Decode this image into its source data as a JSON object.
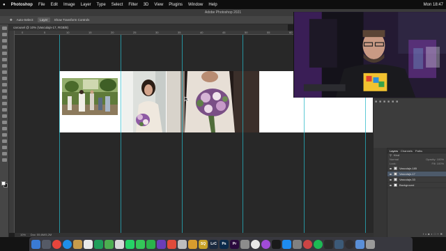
{
  "menubar": {
    "apple": "",
    "items": [
      "Photoshop",
      "File",
      "Edit",
      "Image",
      "Layer",
      "Type",
      "Select",
      "Filter",
      "3D",
      "View",
      "Plugins",
      "Window",
      "Help"
    ],
    "clock": "Mon 18:47"
  },
  "window": {
    "title": "Adobe Photoshop 2021"
  },
  "options": {
    "auto_select": "Auto-Select:",
    "layer_select": "Layer",
    "transform_controls": "Show Transform Controls"
  },
  "document": {
    "tab": "carousel @ 10% (Vasculajn-17, RGB/8)"
  },
  "status": {
    "zoom": "10%",
    "doc_size": "Doc: 55,6M/5,2M"
  },
  "ruler": [
    "0",
    "5",
    "10",
    "15",
    "20",
    "25",
    "30",
    "35",
    "40",
    "45",
    "50",
    "55",
    "60",
    "65",
    "70",
    "75"
  ],
  "layers": {
    "tabs": [
      "Layers",
      "Channels",
      "Paths"
    ],
    "kind": "Kind",
    "blend": "Normal",
    "opacity_label": "Opacity: 100%",
    "lock_label": "Lock:",
    "fill_label": "Fill: 100%",
    "items": [
      {
        "name": "Vasculajn-185",
        "selected": false
      },
      {
        "name": "Vasculajn-17",
        "selected": true
      },
      {
        "name": "Vasculajn-33",
        "selected": false
      },
      {
        "name": "Background",
        "selected": false
      }
    ]
  },
  "dock": {
    "apps": [
      {
        "icon": "finder-icon",
        "color": "#3a7bd5",
        "label": ""
      },
      {
        "icon": "launchpad-icon",
        "color": "#555a66",
        "label": ""
      },
      {
        "icon": "chrome-icon",
        "color": "#e8453c",
        "label": ""
      },
      {
        "icon": "safari-icon",
        "color": "#1f8fe8",
        "label": ""
      },
      {
        "icon": "folder-icon",
        "color": "#c79b4b",
        "label": ""
      },
      {
        "icon": "calendar-icon",
        "color": "#e9e9e9",
        "label": ""
      },
      {
        "icon": "sheets-icon",
        "color": "#1e9e5b",
        "label": ""
      },
      {
        "icon": "maps-icon",
        "color": "#4cae50",
        "label": ""
      },
      {
        "icon": "photos-icon",
        "color": "#d8d8d8",
        "label": ""
      },
      {
        "icon": "whatsapp-icon",
        "color": "#25d366",
        "label": ""
      },
      {
        "icon": "messages-icon",
        "color": "#34c759",
        "label": ""
      },
      {
        "icon": "facetime-icon",
        "color": "#2ab24a",
        "label": ""
      },
      {
        "icon": "imovie-icon",
        "color": "#6a3db8",
        "label": ""
      },
      {
        "icon": "claquette-icon",
        "color": "#e04b3a",
        "label": ""
      },
      {
        "icon": "capture-icon",
        "color": "#bdbdbd",
        "label": ""
      },
      {
        "icon": "app-icon",
        "color": "#d79c2e",
        "label": ""
      },
      {
        "icon": "sq-icon",
        "color": "#c9a227",
        "label": "SQ"
      },
      {
        "icon": "lightroom-classic-icon",
        "color": "#1b2a3f",
        "label": "LrC"
      },
      {
        "icon": "photoshop-icon",
        "color": "#0b2a4a",
        "label": "Ps"
      },
      {
        "icon": "premiere-icon",
        "color": "#2a0a3d",
        "label": "Pr"
      },
      {
        "icon": "utility-icon",
        "color": "#8c8c8c",
        "label": ""
      },
      {
        "icon": "music-icon",
        "color": "#e8e8e8",
        "label": ""
      },
      {
        "icon": "podcasts-icon",
        "color": "#a04bd8",
        "label": ""
      },
      {
        "icon": "tv-icon",
        "color": "#1a1a1a",
        "label": ""
      },
      {
        "icon": "app-store-icon",
        "color": "#1e8cf0",
        "label": ""
      },
      {
        "icon": "preferences-icon",
        "color": "#808080",
        "label": ""
      },
      {
        "icon": "screenshot-icon",
        "color": "#c44",
        "label": ""
      },
      {
        "icon": "spotify-icon",
        "color": "#1db954",
        "label": ""
      },
      {
        "icon": "activity-monitor-icon",
        "color": "#2b2b2b",
        "label": ""
      },
      {
        "icon": "screen-icon",
        "color": "#3c5a78",
        "label": ""
      },
      {
        "icon": "obs-icon",
        "color": "#302e31",
        "label": ""
      },
      {
        "icon": "downloads-icon",
        "color": "#5a8fd8",
        "label": ""
      },
      {
        "icon": "trash-icon",
        "color": "#9a9a9a",
        "label": ""
      }
    ]
  }
}
